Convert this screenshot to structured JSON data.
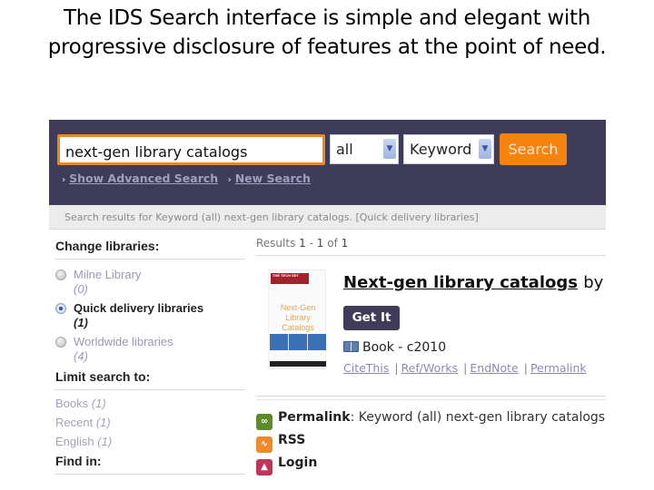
{
  "slide": {
    "title_line1": "The IDS Search interface is simple and elegant with",
    "title_line2": "progressive disclosure of features at the point of need."
  },
  "header": {
    "search_value": "next-gen library catalogs",
    "scope_select": "all",
    "type_select": "Keyword",
    "search_button": "Search",
    "links": [
      "Show Advanced Search",
      "New Search"
    ]
  },
  "crumb": "Search results for Keyword (all) next-gen library catalogs. [Quick delivery libraries]",
  "sidebar": {
    "change_libraries_heading": "Change libraries:",
    "libraries": [
      {
        "name": "Milne Library",
        "count": "(0)",
        "selected": false
      },
      {
        "name": "Quick delivery libraries",
        "count": "(1)",
        "selected": true
      },
      {
        "name": "Worldwide libraries",
        "count": "(4)",
        "selected": false
      }
    ],
    "limit_heading": "Limit search to:",
    "limits": [
      {
        "name": "Books",
        "count": "(1)"
      },
      {
        "name": "Recent",
        "count": "(1)"
      },
      {
        "name": "English",
        "count": "(1)"
      }
    ],
    "find_heading": "Find in:"
  },
  "results": {
    "label": "Results",
    "range_start": "1",
    "range_end": "1",
    "of": "of",
    "total": "1"
  },
  "record": {
    "cover_title": "Next-Gen Library Catalogs",
    "cover_series": "THE TECH SET",
    "title": "Next-gen library catalogs",
    "by": "by",
    "get_it": "Get It",
    "format": "Book - c2010",
    "links": [
      "CiteThis",
      "Ref/Works",
      "EndNote",
      "Permalink"
    ]
  },
  "tools": {
    "permalink_label": "Permalink",
    "permalink_text": ": Keyword (all) next-gen library catalogs.",
    "rss": "RSS",
    "login": "Login"
  },
  "colors": {
    "header_bg": "#3e3c58",
    "accent_orange": "#f7830f",
    "link_muted": "#9f9fc0"
  }
}
